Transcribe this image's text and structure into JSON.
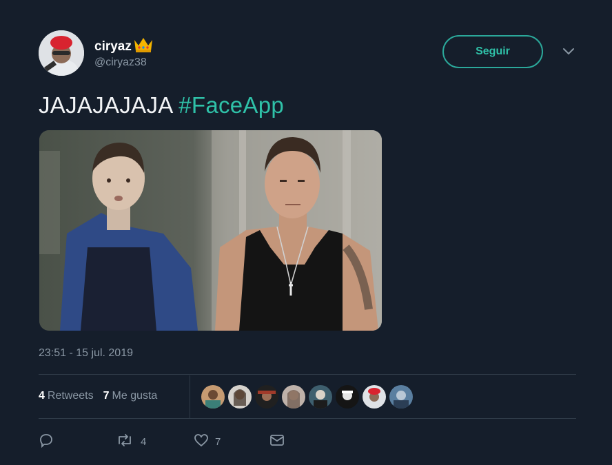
{
  "user": {
    "display_name": "ciryaz",
    "handle": "@ciryaz38"
  },
  "follow_button": {
    "label": "Seguir"
  },
  "tweet": {
    "text": "JAJAJAJAJA",
    "hashtag": "#FaceApp",
    "timestamp": "23:51 - 15 jul. 2019"
  },
  "stats": {
    "retweets_count": "4",
    "retweets_label": "Retweets",
    "likes_count": "7",
    "likes_label": "Me gusta"
  },
  "actions": {
    "retweet_count": "4",
    "like_count": "7"
  },
  "icons": {
    "reply": "reply-icon",
    "retweet": "retweet-icon",
    "like": "heart-icon",
    "dm": "envelope-icon",
    "more": "chevron-down-icon",
    "badge": "crown-emoji"
  },
  "colors": {
    "background": "#151e2b",
    "accent": "#2fc1a8",
    "muted": "#8b98a5"
  }
}
